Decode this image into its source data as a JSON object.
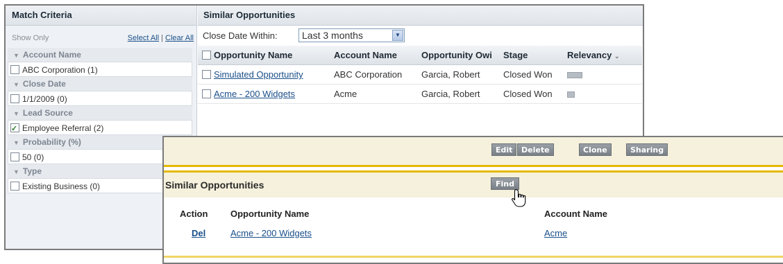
{
  "criteria": {
    "title": "Match Criteria",
    "show_only": "Show Only",
    "select_all": "Select All",
    "separator": "|",
    "clear_all": "Clear All",
    "groups": [
      {
        "label": "Account Name",
        "item": "ABC Corporation (1)",
        "checked": false
      },
      {
        "label": "Close Date",
        "item": "1/1/2009 (0)",
        "checked": false
      },
      {
        "label": "Lead Source",
        "item": "Employee Referral (2)",
        "checked": true
      },
      {
        "label": "Probability (%)",
        "item": "50 (0)",
        "checked": false
      },
      {
        "label": "Type",
        "item": "Existing Business (0)",
        "checked": false
      }
    ]
  },
  "similar": {
    "title": "Similar Opportunities",
    "close_date_label": "Close Date Within:",
    "close_date_value": "Last 3 months",
    "columns": [
      "Opportunity Name",
      "Account Name",
      "Opportunity Owi",
      "Stage",
      "Relevancy"
    ],
    "rows": [
      {
        "name": "Simulated Opportunity",
        "account": "ABC Corporation",
        "owner": "Garcia, Robert",
        "stage": "Closed Won",
        "relevancy": 1.0
      },
      {
        "name": "Acme - 200 Widgets",
        "account": "Acme",
        "owner": "Garcia, Robert",
        "stage": "Closed Won",
        "relevancy": 0.45
      }
    ]
  },
  "record": {
    "buttons": [
      "Edit",
      "Delete",
      "Clone",
      "Sharing"
    ],
    "related_title": "Similar Opportunities",
    "find_label": "Find",
    "columns": [
      "Action",
      "Opportunity Name",
      "Account Name"
    ],
    "row": {
      "action": "Del",
      "name": "Acme - 200 Widgets",
      "account": "Acme"
    }
  }
}
